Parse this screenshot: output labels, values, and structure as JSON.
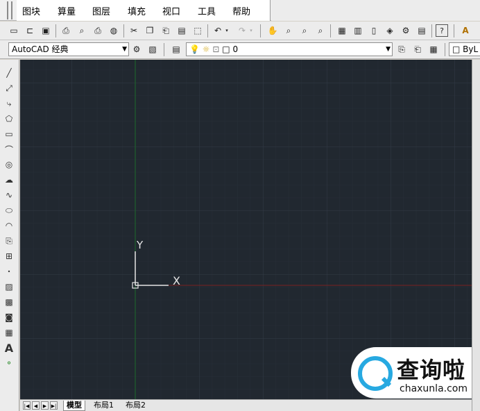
{
  "menubar": {
    "items": [
      {
        "label": "图块"
      },
      {
        "label": "算量"
      },
      {
        "label": "图层"
      },
      {
        "label": "填充"
      },
      {
        "label": "视口"
      },
      {
        "label": "工具"
      },
      {
        "label": "帮助"
      }
    ]
  },
  "toolbar1": {
    "icons": [
      "new-icon",
      "open-icon",
      "save-icon",
      "print-icon",
      "preview-icon",
      "plot-icon",
      "publish-icon",
      "cut-icon",
      "copy-icon",
      "paste-icon",
      "matchprop-icon",
      "block-icon",
      "undo-icon",
      "redo-icon",
      "pan-icon",
      "zoom-realtime-icon",
      "zoom-window-icon",
      "zoom-previous-icon",
      "properties-icon",
      "design-center-icon",
      "tool-palette-icon",
      "sheetset-icon",
      "markup-icon",
      "calculator-icon",
      "help-icon",
      "text-style-icon"
    ]
  },
  "toolbar2": {
    "workspace_value": "AutoCAD 经典",
    "layer_value": "0",
    "color_value": "ByL"
  },
  "canvas": {
    "ucs_x_label": "X",
    "ucs_y_label": "Y",
    "background_color": "#212830",
    "grid_color": "#2f3842"
  },
  "tabs": {
    "model": "模型",
    "layout1": "布局1",
    "layout2": "布局2"
  },
  "watermark": {
    "title": "查询啦",
    "subtitle": "chaxunla.com"
  }
}
